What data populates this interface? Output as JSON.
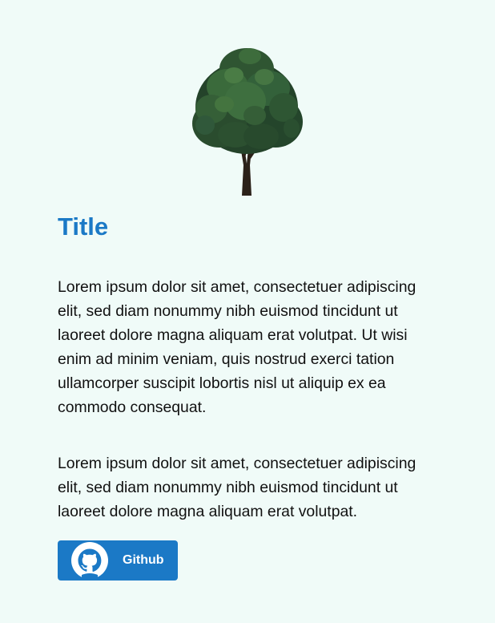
{
  "header": {
    "image_icon": "tree-image"
  },
  "content": {
    "title": "Title",
    "paragraphs": [
      "Lorem ipsum dolor sit amet, consectetuer adipiscing elit, sed diam nonummy nibh euismod tincidunt ut laoreet dolore magna aliquam erat volutpat. Ut wisi enim ad minim veniam, quis nostrud exerci tation ullamcorper suscipit lobortis nisl ut aliquip ex ea commodo consequat.",
      "Lorem ipsum dolor sit amet, consectetuer adipiscing elit, sed diam nonummy nibh euismod tincidunt ut laoreet dolore magna aliquam erat volutpat."
    ]
  },
  "button": {
    "label": "Github",
    "icon": "github-icon"
  },
  "colors": {
    "background": "#f0fbf8",
    "accent": "#1b79c6",
    "text": "#111111"
  }
}
